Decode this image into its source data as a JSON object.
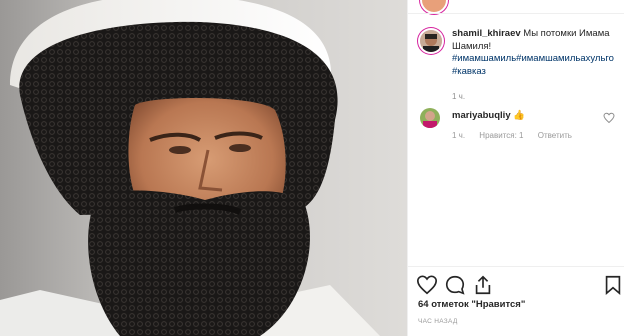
{
  "post": {
    "author": "shamil_khiraev",
    "caption_text": " Мы потомки Имама Шамиля!",
    "hashtags": "#имамшамиль#имамшамильахульго #кавказ",
    "caption_age": "1 ч."
  },
  "comment": {
    "author": "mariyabuqliy",
    "text": " 👍",
    "age": "1 ч.",
    "likes": "Нравится: 1",
    "reply": "Ответить"
  },
  "footer": {
    "likes_text": "64 отметок \"Нравится\"",
    "timestamp": "ЧАС НАЗАД"
  },
  "colors": {
    "hashtag": "#003569",
    "story_ring": "#d6249f"
  }
}
